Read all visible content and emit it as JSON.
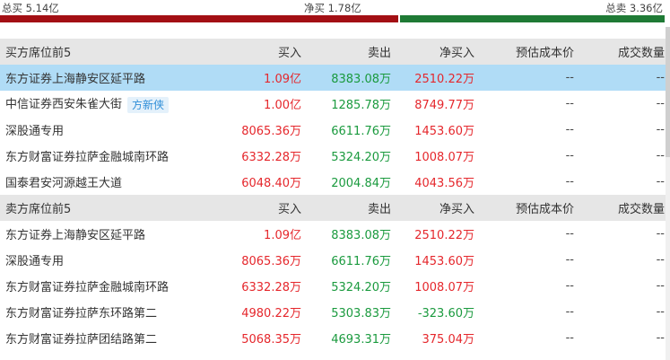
{
  "summary": {
    "total_buy": "总买 5.14亿",
    "net_buy": "净买 1.78亿",
    "total_sell": "总卖 3.36亿"
  },
  "columns": [
    "买入",
    "卖出",
    "净买入",
    "预估成本价",
    "成交数量"
  ],
  "buy_section": {
    "title": "买方席位前5",
    "rows": [
      {
        "name": "东方证券上海静安区延平路",
        "buy": "1.09亿",
        "sell": "8383.08万",
        "net": "2510.22万",
        "cost": "--",
        "volume": "--",
        "tag": ""
      },
      {
        "name": "中信证券西安朱雀大街",
        "buy": "1.00亿",
        "sell": "1285.78万",
        "net": "8749.77万",
        "cost": "--",
        "volume": "--",
        "tag": "方新侠"
      },
      {
        "name": "深股通专用",
        "buy": "8065.36万",
        "sell": "6611.76万",
        "net": "1453.60万",
        "cost": "--",
        "volume": "--",
        "tag": ""
      },
      {
        "name": "东方财富证券拉萨金融城南环路",
        "buy": "6332.28万",
        "sell": "5324.20万",
        "net": "1008.07万",
        "cost": "--",
        "volume": "--",
        "tag": ""
      },
      {
        "name": "国泰君安河源越王大道",
        "buy": "6048.40万",
        "sell": "2004.84万",
        "net": "4043.56万",
        "cost": "--",
        "volume": "--",
        "tag": ""
      }
    ]
  },
  "sell_section": {
    "title": "卖方席位前5",
    "rows": [
      {
        "name": "东方证券上海静安区延平路",
        "buy": "1.09亿",
        "sell": "8383.08万",
        "net": "2510.22万",
        "cost": "--",
        "volume": "--"
      },
      {
        "name": "深股通专用",
        "buy": "8065.36万",
        "sell": "6611.76万",
        "net": "1453.60万",
        "cost": "--",
        "volume": "--"
      },
      {
        "name": "东方财富证券拉萨金融城南环路",
        "buy": "6332.28万",
        "sell": "5324.20万",
        "net": "1008.07万",
        "cost": "--",
        "volume": "--"
      },
      {
        "name": "东方财富证券拉萨东环路第二",
        "buy": "4980.22万",
        "sell": "5303.83万",
        "net": "-323.60万",
        "cost": "--",
        "volume": "--"
      },
      {
        "name": "东方财富证券拉萨团结路第二",
        "buy": "5068.35万",
        "sell": "4693.31万",
        "net": "375.04万",
        "cost": "--",
        "volume": "--"
      }
    ]
  },
  "colors": {
    "buy_red": "#e5272c",
    "sell_green": "#1a9a3e",
    "bar_red": "#a30f14",
    "bar_green": "#1f7a35",
    "selected_row": "#b0dcf6",
    "header_bg": "#e6e6e6"
  }
}
